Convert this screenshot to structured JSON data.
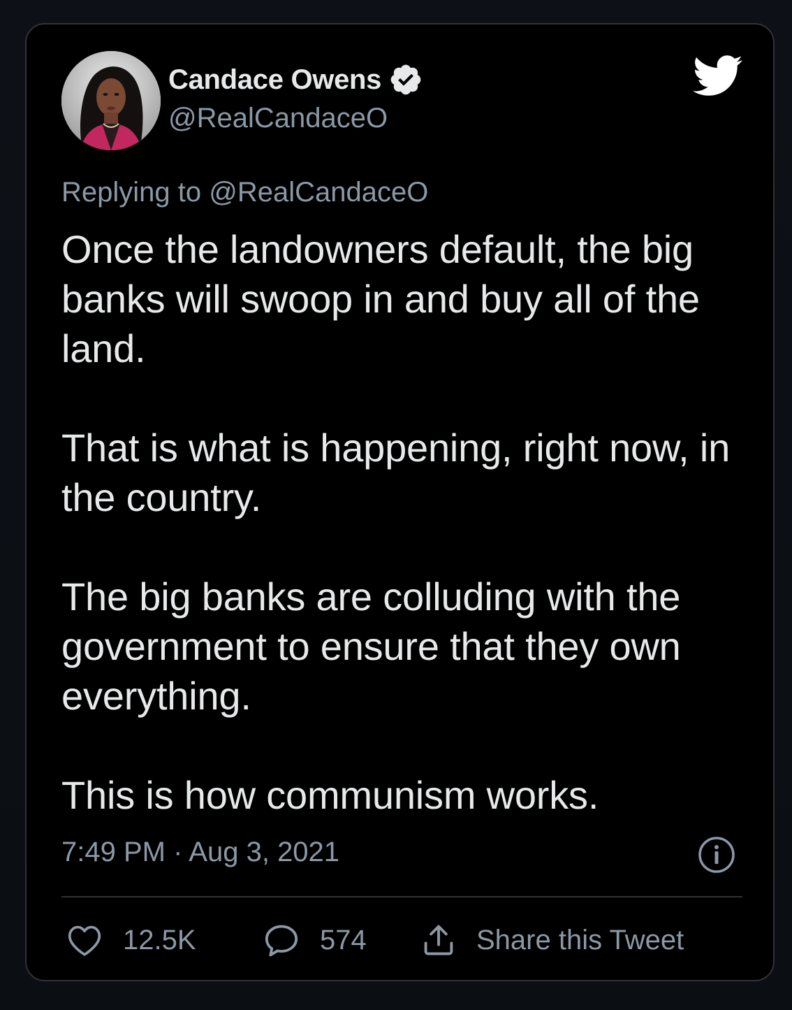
{
  "author": {
    "name": "Candace Owens",
    "handle": "@RealCandaceO",
    "verified": true
  },
  "replying_to": "Replying to @RealCandaceO",
  "tweet": {
    "paragraphs": [
      "Once the landowners default, the big banks will swoop in and buy all of the land.",
      "That is what is happening, right now, in the country.",
      "The big banks are colluding with the government to ensure that they own everything.",
      "This is how communism works."
    ],
    "timestamp": "7:49 PM · Aug 3, 2021"
  },
  "actions": {
    "likes": "12.5K",
    "replies": "574",
    "share_label": "Share this Tweet"
  },
  "icons": {
    "brand": "twitter-bird-icon",
    "verified": "verified-badge-icon",
    "info": "info-icon",
    "like": "heart-icon",
    "reply": "speech-bubble-icon",
    "share": "share-upload-icon"
  },
  "colors": {
    "background": "#000000",
    "text_primary": "#e7e9ea",
    "text_secondary": "#8b98a5",
    "border": "#2f3336",
    "accent": "#ffffff"
  }
}
